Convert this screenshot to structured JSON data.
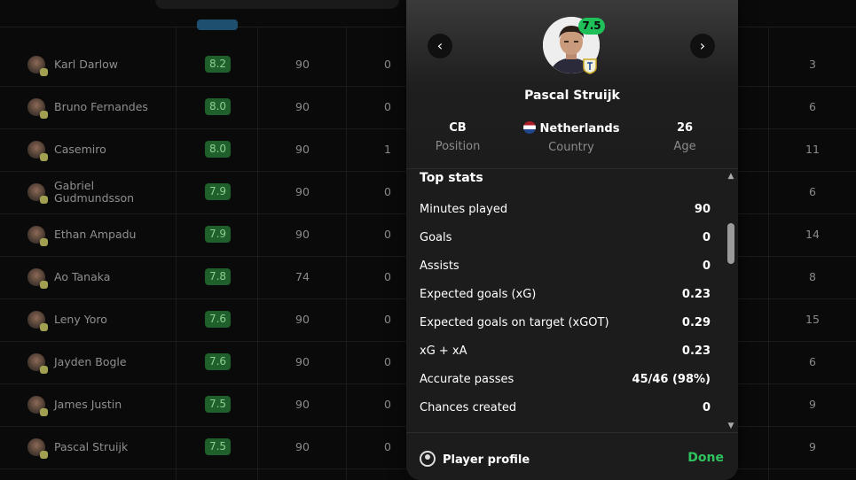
{
  "table": {
    "rows": [
      {
        "name": "Karl Darlow",
        "rating": "8.2",
        "minutes": "90",
        "col4": "0",
        "last": "3"
      },
      {
        "name": "Bruno Fernandes",
        "rating": "8.0",
        "minutes": "90",
        "col4": "0",
        "last": "6"
      },
      {
        "name": "Casemiro",
        "rating": "8.0",
        "minutes": "90",
        "col4": "1",
        "last": "11"
      },
      {
        "name": "Gabriel Gudmundsson",
        "rating": "7.9",
        "minutes": "90",
        "col4": "0",
        "last": "6"
      },
      {
        "name": "Ethan Ampadu",
        "rating": "7.9",
        "minutes": "90",
        "col4": "0",
        "last": "14"
      },
      {
        "name": "Ao Tanaka",
        "rating": "7.8",
        "minutes": "74",
        "col4": "0",
        "last": "8"
      },
      {
        "name": "Leny Yoro",
        "rating": "7.6",
        "minutes": "90",
        "col4": "0",
        "last": "15"
      },
      {
        "name": "Jayden Bogle",
        "rating": "7.6",
        "minutes": "90",
        "col4": "0",
        "last": "6"
      },
      {
        "name": "James Justin",
        "rating": "7.5",
        "minutes": "90",
        "col4": "0",
        "last": "9"
      },
      {
        "name": "Pascal Struijk",
        "rating": "7.5",
        "minutes": "90",
        "col4": "0",
        "last": "9"
      }
    ]
  },
  "modal": {
    "rating": "7.5",
    "player_name": "Pascal Struijk",
    "position": {
      "value": "CB",
      "label": "Position"
    },
    "country": {
      "value": "Netherlands",
      "label": "Country"
    },
    "age": {
      "value": "26",
      "label": "Age"
    },
    "prev_label": "‹",
    "next_label": "›",
    "section_title": "Top stats",
    "stats": [
      {
        "label": "Minutes played",
        "value": "90"
      },
      {
        "label": "Goals",
        "value": "0"
      },
      {
        "label": "Assists",
        "value": "0"
      },
      {
        "label": "Expected goals (xG)",
        "value": "0.23"
      },
      {
        "label": "Expected goals on target (xGOT)",
        "value": "0.29"
      },
      {
        "label": "xG + xA",
        "value": "0.23"
      },
      {
        "label": "Accurate passes",
        "value": "45/46 (98%)"
      },
      {
        "label": "Chances created",
        "value": "0"
      }
    ],
    "footer": {
      "profile_label": "Player profile",
      "done_label": "Done"
    },
    "accent": "#2fc45f",
    "rating_badge_color": "#1fbf5a"
  }
}
